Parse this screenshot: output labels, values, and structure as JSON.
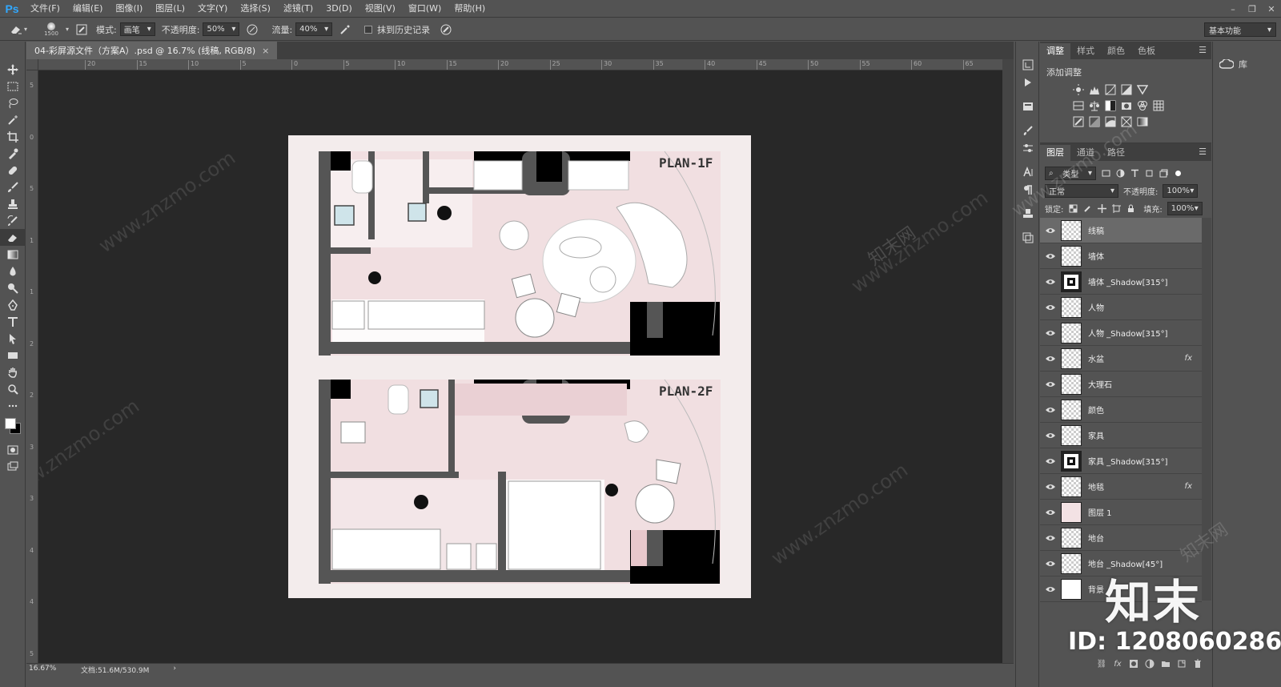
{
  "app": {
    "logo": "Ps"
  },
  "menu": [
    "文件(F)",
    "编辑(E)",
    "图像(I)",
    "图层(L)",
    "文字(Y)",
    "选择(S)",
    "滤镜(T)",
    "3D(D)",
    "视图(V)",
    "窗口(W)",
    "帮助(H)"
  ],
  "window_controls": [
    "–",
    "❐",
    "✕"
  ],
  "options": {
    "brush_size": "1500",
    "mode_label": "模式:",
    "mode_value": "画笔",
    "opacity_label": "不透明度:",
    "opacity_value": "50%",
    "flow_label": "流量:",
    "flow_value": "40%",
    "history_label": "抹到历史记录",
    "workspace": "基本功能"
  },
  "document": {
    "tab_title": "04-彩屏源文件（方案A）.psd @ 16.7% (线稿, RGB/8)",
    "close": "×",
    "plan1_label": "PLAN-1F",
    "plan2_label": "PLAN-2F"
  },
  "ruler_top": [
    "20",
    "15",
    "10",
    "5",
    "0",
    "5",
    "10",
    "15",
    "20",
    "25",
    "30",
    "35",
    "40",
    "45",
    "50",
    "55",
    "60",
    "65"
  ],
  "ruler_left": [
    "5",
    "0",
    "5",
    "1",
    "1",
    "2",
    "2",
    "3",
    "3",
    "4",
    "4",
    "5"
  ],
  "status": {
    "zoom": "16.67%",
    "doc": "文档:51.6M/530.9M",
    "arrow": "›"
  },
  "adjust_panel": {
    "tabs": [
      "调整",
      "样式",
      "颜色",
      "色板"
    ],
    "title": "添加调整"
  },
  "layers_panel": {
    "tabs": [
      "图层",
      "通道",
      "路径"
    ],
    "filter_label": "类型",
    "blend_mode": "正常",
    "opacity_label": "不透明度:",
    "opacity_value": "100%",
    "lock_label": "锁定:",
    "fill_label": "填充:",
    "fill_value": "100%",
    "layers": [
      {
        "name": "线稿",
        "fx": ""
      },
      {
        "name": "墙体",
        "fx": ""
      },
      {
        "name": "墙体 _Shadow[315°]",
        "fx": ""
      },
      {
        "name": "人物",
        "fx": ""
      },
      {
        "name": "人物 _Shadow[315°]",
        "fx": ""
      },
      {
        "name": "水盆",
        "fx": "fx"
      },
      {
        "name": "大理石",
        "fx": ""
      },
      {
        "name": "颜色",
        "fx": ""
      },
      {
        "name": "家具",
        "fx": ""
      },
      {
        "name": "家具 _Shadow[315°]",
        "fx": ""
      },
      {
        "name": "地毯",
        "fx": "fx"
      },
      {
        "name": "图层 1",
        "fx": ""
      },
      {
        "name": "地台",
        "fx": ""
      },
      {
        "name": "地台 _Shadow[45°]",
        "fx": ""
      },
      {
        "name": "背景",
        "fx": ""
      }
    ]
  },
  "libraries": {
    "label": "库"
  },
  "watermark": {
    "brand": "知末",
    "id": "ID: 1208060286",
    "site": "www.znzmo.com",
    "site_cn": "知末网"
  }
}
